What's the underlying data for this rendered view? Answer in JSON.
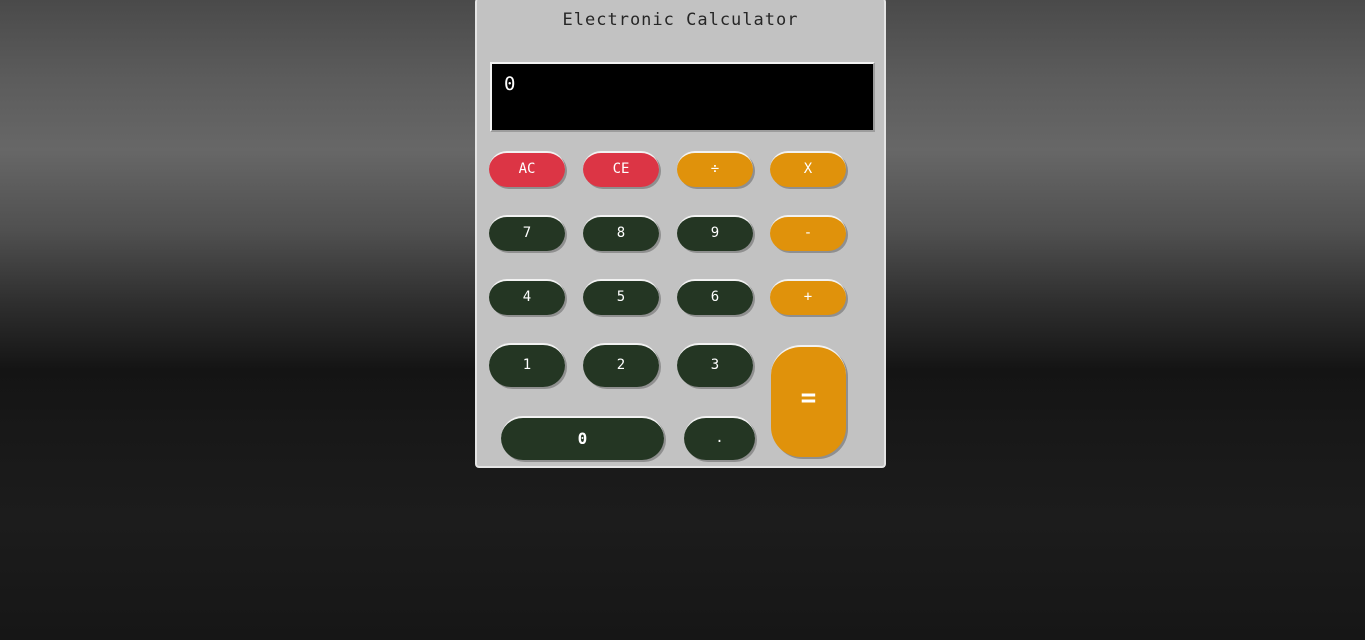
{
  "calculator": {
    "title": "Electronic Calculator",
    "display_value": "0"
  },
  "keys": {
    "ac": "AC",
    "ce": "CE",
    "divide": "÷",
    "multiply": "X",
    "seven": "7",
    "eight": "8",
    "nine": "9",
    "subtract": "-",
    "four": "4",
    "five": "5",
    "six": "6",
    "add": "+",
    "one": "1",
    "two": "2",
    "three": "3",
    "equals": "=",
    "zero": "0",
    "decimal": "."
  },
  "colors": {
    "clear_keys": "#dc3545",
    "operator_keys": "#e0920b",
    "digit_keys": "#243623",
    "body": "#c2c2c2",
    "display": "#000000"
  }
}
